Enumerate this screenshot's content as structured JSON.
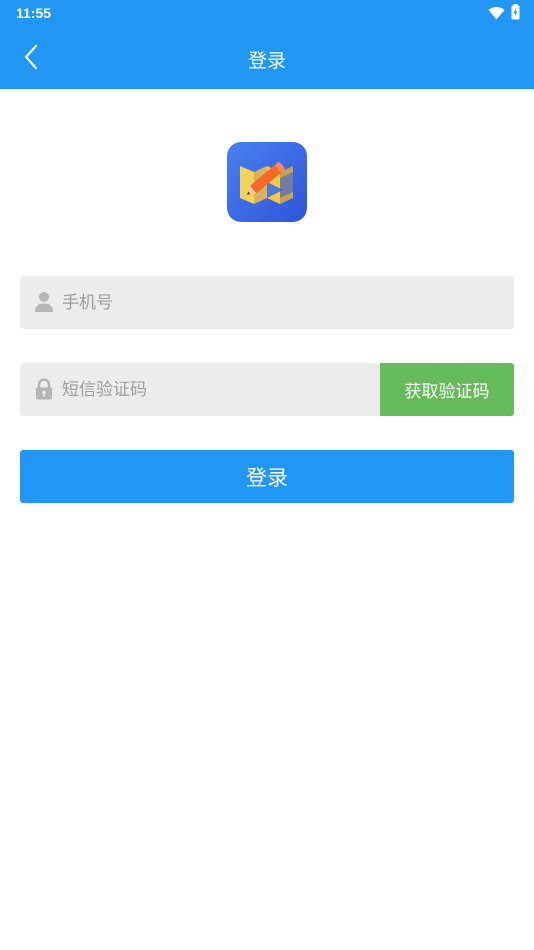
{
  "status_bar": {
    "time": "11:55",
    "icons": [
      "wifi-icon",
      "battery-icon"
    ]
  },
  "app_bar": {
    "title": "登录",
    "back_icon": "chevron-left-icon"
  },
  "logo": {
    "icon": "app-logo-pencil-map"
  },
  "form": {
    "phone": {
      "placeholder": "手机号",
      "value": "",
      "icon": "user-icon"
    },
    "code": {
      "placeholder": "短信验证码",
      "value": "",
      "icon": "lock-icon"
    },
    "get_code_label": "获取验证码",
    "login_label": "登录"
  },
  "colors": {
    "primary": "#2196f3",
    "code_button": "#66bb5a",
    "field_background": "#ececec",
    "placeholder": "#9e9e9e"
  }
}
